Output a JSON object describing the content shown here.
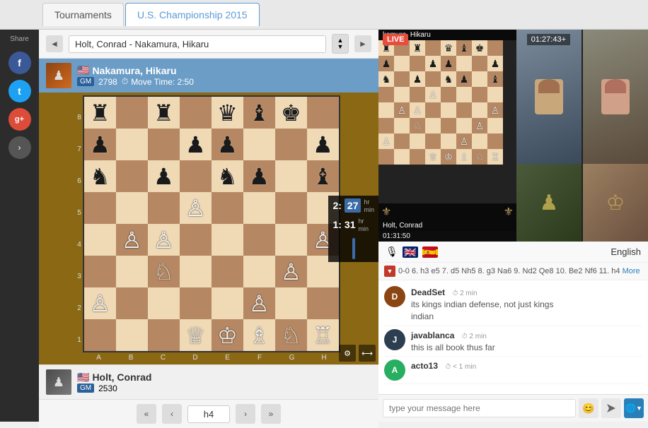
{
  "tabs": [
    {
      "label": "Tournaments",
      "active": false
    },
    {
      "label": "U.S. Championship 2015",
      "active": true
    }
  ],
  "share": {
    "label": "Share",
    "social": [
      {
        "name": "facebook",
        "symbol": "f",
        "color": "#3b5998"
      },
      {
        "name": "twitter",
        "symbol": "t",
        "color": "#1da1f2"
      },
      {
        "name": "google-plus",
        "symbol": "g+",
        "color": "#dd4b39"
      }
    ]
  },
  "game_selector": {
    "prev_label": "◄",
    "next_label": "►",
    "game_title": "Holt, Conrad - Nakamura, Hikaru",
    "dropdown_symbol": "⬆⬇"
  },
  "players": {
    "top": {
      "name": "Nakamura, Hikaru",
      "flag": "🇺🇸",
      "title": "GM",
      "rating": "2798",
      "move_time": "Move Time: 2:50",
      "clock": "2:27",
      "clock_label": "hr  min"
    },
    "bottom": {
      "name": "Holt, Conrad",
      "flag": "🇺🇸",
      "title": "GM",
      "rating": "2530",
      "clock": "1:31:50"
    }
  },
  "board": {
    "ranks": [
      "8",
      "7",
      "6",
      "5",
      "4",
      "3",
      "2",
      "1"
    ],
    "files": [
      "A",
      "B",
      "C",
      "D",
      "E",
      "F",
      "G",
      "H"
    ],
    "pieces": [
      [
        "♜",
        "",
        "♜",
        "",
        "♛",
        "♝",
        "♚",
        ""
      ],
      [
        "♟",
        "",
        "",
        "♟",
        "♟",
        "",
        "",
        "♟"
      ],
      [
        "♞",
        "",
        "♟",
        "",
        "♞",
        "♟",
        "",
        "♝"
      ],
      [
        "",
        "",
        "",
        "♙",
        "",
        "",
        "",
        ""
      ],
      [
        "",
        "♙",
        "♙",
        "",
        "",
        "",
        "",
        "♙"
      ],
      [
        "",
        "",
        "♘",
        "",
        "",
        "",
        "♙",
        ""
      ],
      [
        "♙",
        "",
        "",
        "",
        "",
        "♙",
        "",
        ""
      ],
      [
        "",
        "",
        "",
        "♕",
        "♔",
        "♗",
        "♘",
        "♖"
      ]
    ]
  },
  "move_nav": {
    "first_label": "«",
    "prev_label": "‹",
    "current_move": "h4",
    "next_label": "›",
    "last_label": "»"
  },
  "video": {
    "live_label": "LIVE",
    "top_player": "▪ kamura, Hikaru",
    "timer_top": "01:27:43+",
    "bottom_player": "Holt, Conrad",
    "timer_bottom": "01:31:50"
  },
  "chat": {
    "language": "English",
    "moves_text": "0-0 6. h3 e5 7. d5 Nh5 8. g3 Na6 9. Nd2 Qe8 10. Be2 Nf6 11. h4",
    "more_link": "More",
    "messages": [
      {
        "username": "DeadSet",
        "time": "2 min",
        "text": "its kings indian defense, not just kings\nindian",
        "avatar_letter": "D",
        "avatar_color": "#8B4513"
      },
      {
        "username": "javablanca",
        "time": "2 min",
        "text": "this is all book thus far",
        "avatar_letter": "J",
        "avatar_color": "#2c3e50"
      },
      {
        "username": "acto13",
        "time": "< 1 min",
        "text": "",
        "avatar_letter": "A",
        "avatar_color": "#27ae60"
      }
    ],
    "input_placeholder": "type your message here"
  }
}
